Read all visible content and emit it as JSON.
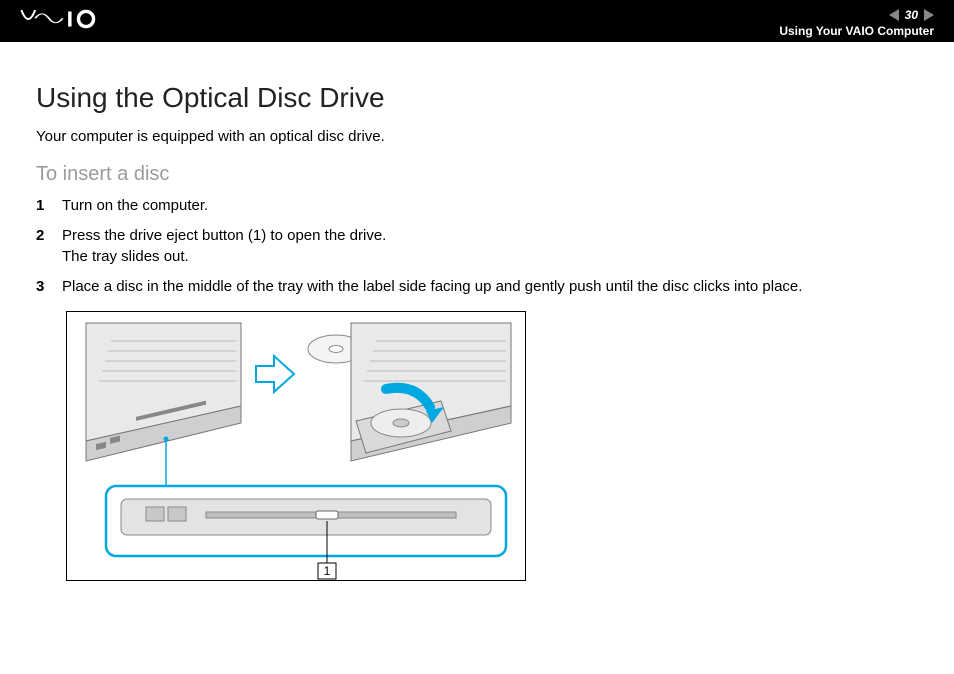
{
  "header": {
    "page_number": "30",
    "section_title": "Using Your VAIO Computer"
  },
  "main": {
    "title": "Using the Optical Disc Drive",
    "intro": "Your computer is equipped with an optical disc drive.",
    "subheading": "To insert a disc",
    "steps": [
      {
        "num": "1",
        "text": "Turn on the computer."
      },
      {
        "num": "2",
        "text": "Press the drive eject button (1) to open the drive.\nThe tray slides out."
      },
      {
        "num": "3",
        "text": "Place a disc in the middle of the tray with the label side facing up and gently push until the disc clicks into place."
      }
    ],
    "callout_label": "1"
  }
}
